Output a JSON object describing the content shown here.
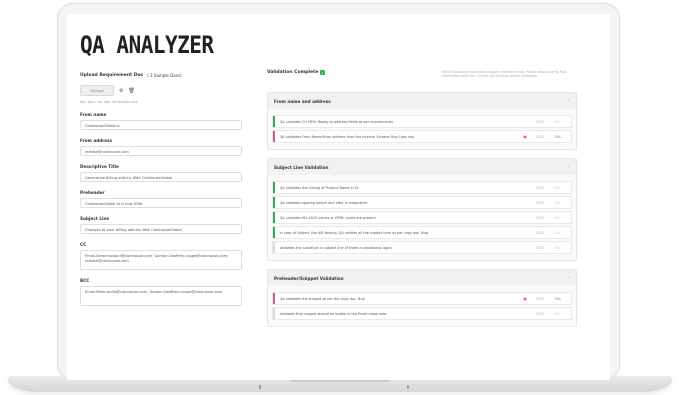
{
  "app": {
    "title": "QA ANALYZER"
  },
  "upload": {
    "label": "Upload Requirement Doc",
    "sample_link": "( 2 Sample Docs)",
    "button_label": "Upload",
    "hint": "doc, docx, xls, xlsx, txt formats only"
  },
  "fields": [
    {
      "label": "From name",
      "value": "CoinhouseGlobal.io"
    },
    {
      "label": "From address",
      "value": "release@coinhouse.com"
    },
    {
      "label": "Descriptive Title",
      "value": "Generative Billing add-ins With CoinhouseGlobal"
    },
    {
      "label": "Preheader",
      "value": "CoinhouseGlobal AI is now GENI"
    },
    {
      "label": "Subject Line",
      "value": "Changes to your billing add-ins With CoinhouseGlobal"
    },
    {
      "label": "CC",
      "value": "Email-Drew.mosse.d@coinhouse.com; Gordon.Geoffrey-coupe@coinhouse.com; release@coinhouse.com",
      "tall": true
    },
    {
      "label": "BCC",
      "value": "Email-Peter.wallis@coinhouse.com; Gordon.Geoffrey-coupe@coinhouse.com",
      "tall": true
    }
  ],
  "validation": {
    "title": "Validation Complete",
    "note": "While Coinhouse documents require internal review. Please always verify final information with line 1 of the QA Analyzer before validation."
  },
  "sections": [
    {
      "title": "From name and address",
      "rules": [
        {
          "text": "QA validates CU HEVL Ready to address fields as per requirements",
          "status": "pass",
          "pass_label": "PASS",
          "fail_label": "FAIL"
        },
        {
          "text": "QA validates From Name/From Address from the internal Screens Bug Copy doc",
          "status": "fail",
          "pass_label": "PASS",
          "fail_label": "FAIL",
          "doc": true
        }
      ]
    },
    {
      "title": "Subject Line Validation",
      "rules": [
        {
          "text": "QA validates the Casing of Product Name in SL",
          "status": "pass",
          "pass_label": "PASS",
          "fail_label": "FAIL"
        },
        {
          "text": "QA validates spacing before and after in subjectline",
          "status": "pass",
          "pass_label": "PASS",
          "fail_label": "FAIL"
        },
        {
          "text": "QA validates NO ASCII values or HTML codes are present",
          "status": "pass",
          "pass_label": "PASS",
          "fail_label": "FAIL"
        },
        {
          "text": "In case of Subject line A/B testing, QA verifies all the subject lines as per copy doc, Bug",
          "status": "pass",
          "pass_label": "PASS",
          "fail_label": "FAIL"
        },
        {
          "text": "Validates the Condition in subject line (if there is conditional logic)",
          "status": "none",
          "pass_label": "PASS",
          "fail_label": "FAIL"
        }
      ]
    },
    {
      "title": "Preheader/Snippet Validation",
      "rules": [
        {
          "text": "QA validates the snippet as per the copy doc, Bug",
          "status": "fail",
          "pass_label": "PASS",
          "fail_label": "FAIL",
          "doc": true
        },
        {
          "text": "Validates that snippet should be visible in the Email Inbox area",
          "status": "none",
          "pass_label": "PASS",
          "fail_label": "FAIL"
        }
      ]
    }
  ],
  "colors": {
    "pass": "#3aa757",
    "fail": "#e25b6b",
    "none": "#d8dadd"
  },
  "icons": {
    "settings": "gear-icon",
    "delete": "trash-icon",
    "check": "check-icon",
    "chevron": "chevron-up-icon",
    "doc": "document-icon"
  }
}
